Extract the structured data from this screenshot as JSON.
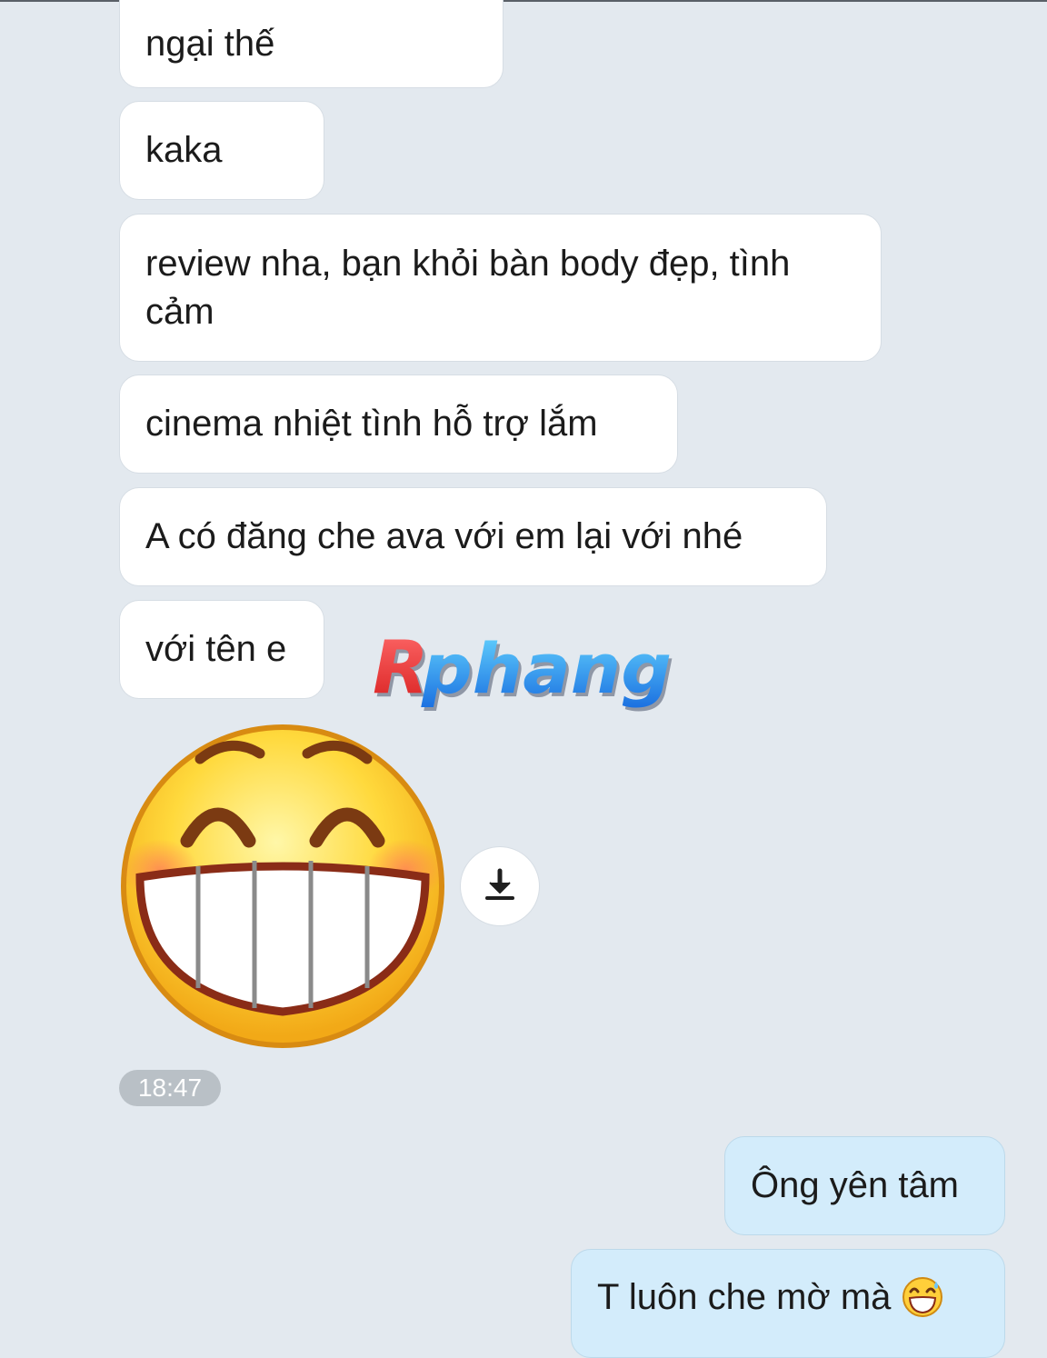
{
  "messages": [
    {
      "direction": "incoming",
      "text": "ngại thế"
    },
    {
      "direction": "incoming",
      "text": "kaka"
    },
    {
      "direction": "incoming",
      "text": "review nha, bạn khỏi bàn body đẹp, tình cảm"
    },
    {
      "direction": "incoming",
      "text": "cinema nhiệt tình hỗ trợ lắm"
    },
    {
      "direction": "incoming",
      "text": "A có đăng che ava với em lại với nhé"
    },
    {
      "direction": "incoming",
      "text": "với tên e"
    },
    {
      "direction": "outgoing",
      "text": "Ông yên tâm"
    },
    {
      "direction": "outgoing",
      "text": "T luôn che mờ mà",
      "emoji": "laughing-sweat-emoji"
    }
  ],
  "sticker": {
    "icon": "big-grin-emoji",
    "download_icon": "download-arrow-icon"
  },
  "timestamp": "18:47",
  "watermark": {
    "text": "Rphang"
  },
  "colors": {
    "background": "#e3e9ef",
    "incoming_bubble": "#ffffff",
    "outgoing_bubble": "#d3ecfb",
    "timestamp_badge": "#b9c0c6"
  }
}
